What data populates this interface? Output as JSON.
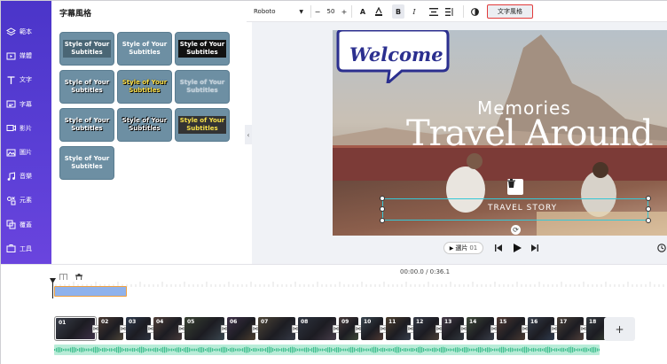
{
  "rail": {
    "items": [
      {
        "label": "範本",
        "icon": "layers-icon"
      },
      {
        "label": "媒體",
        "icon": "media-icon"
      },
      {
        "label": "文字",
        "icon": "text-icon"
      },
      {
        "label": "字幕",
        "icon": "subtitle-icon"
      },
      {
        "label": "影片",
        "icon": "video-icon"
      },
      {
        "label": "圖片",
        "icon": "image-icon"
      },
      {
        "label": "音樂",
        "icon": "music-icon"
      },
      {
        "label": "元素",
        "icon": "elements-icon"
      },
      {
        "label": "覆蓋",
        "icon": "overlay-icon"
      },
      {
        "label": "工具",
        "icon": "tools-icon"
      }
    ]
  },
  "panel": {
    "title": "字幕風格",
    "tiles": [
      {
        "line1": "Style of Your",
        "line2": "Subtitles"
      },
      {
        "line1": "Style of Your",
        "line2": "Subtitles"
      },
      {
        "line1": "Style of Your",
        "line2": "Subtitles"
      },
      {
        "line1": "Style of Your",
        "line2": "Subtitles"
      },
      {
        "line1": "Style of Your",
        "line2": "Subtitles"
      },
      {
        "line1": "Style of Your",
        "line2": "Subtitles"
      },
      {
        "line1": "Style of Your",
        "line2": "Subtitles"
      },
      {
        "line1": "Style of Your",
        "line2": "Subtitles"
      },
      {
        "line1": "Style of Your",
        "line2": "Subtitles"
      },
      {
        "line1": "Style of Your",
        "line2": "Subtitles"
      }
    ]
  },
  "toolbar": {
    "font": "Roboto",
    "font_size": "50",
    "minus": "−",
    "plus": "+",
    "bold": "B",
    "italic": "I",
    "text_style_button": "文字風格"
  },
  "canvas": {
    "welcome": "Welcome",
    "memories": "Memories",
    "travel": "Travel Around",
    "subtitle_text": "TRAVEL STORY"
  },
  "playback": {
    "select_clip": "選片",
    "clip_no": "01"
  },
  "timeline": {
    "timecode": "00:00.0 / 0:36.1",
    "add_label": "+",
    "clips": [
      "01",
      "02",
      "03",
      "04",
      "05",
      "06",
      "07",
      "08",
      "09",
      "10",
      "11",
      "12",
      "13",
      "14",
      "15",
      "16",
      "17",
      "18"
    ]
  },
  "colors": {
    "rail_gradient_start": "#4b35c9",
    "highlight_border": "#e23b3b",
    "selection": "#35c8d8",
    "audio_track": "#b9ecd8",
    "text_track": "#8fb2ec"
  }
}
